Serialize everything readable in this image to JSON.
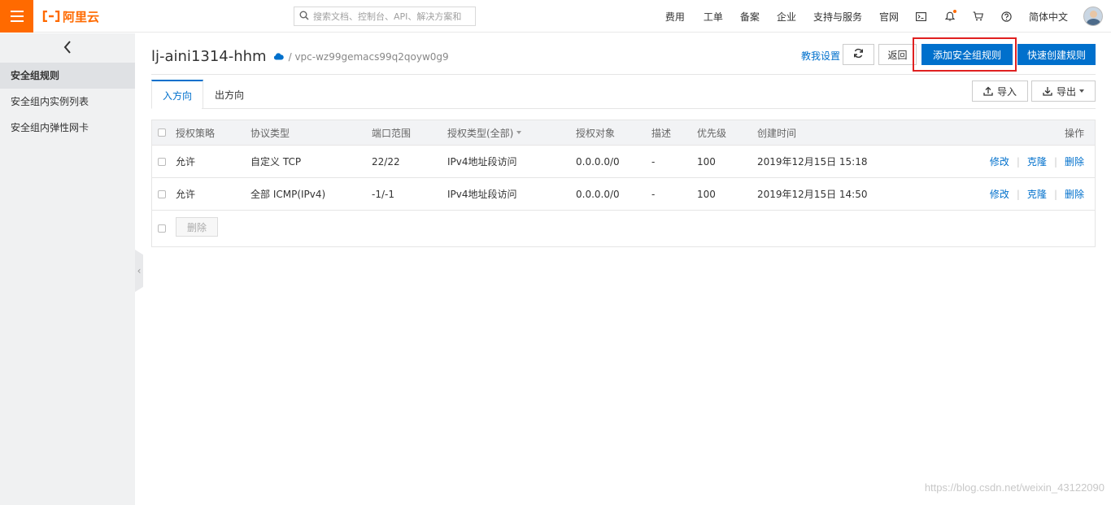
{
  "header": {
    "brand": "阿里云",
    "search_placeholder": "搜索文档、控制台、API、解决方案和",
    "nav": [
      "费用",
      "工单",
      "备案",
      "企业",
      "支持与服务",
      "官网"
    ],
    "language": "简体中文"
  },
  "sidebar": {
    "items": [
      "安全组规则",
      "安全组内实例列表",
      "安全组内弹性网卡"
    ],
    "active_index": 0
  },
  "page": {
    "title": "lj-aini1314-hhm",
    "vpc_path": "/ vpc-wz99gemacs99q2qoyw0g9",
    "teach_link": "教我设置",
    "back_label": "返回",
    "add_rule_label": "添加安全组规则",
    "quick_create_label": "快速创建规则",
    "import_label": "导入",
    "export_label": "导出"
  },
  "tabs": [
    {
      "label": "入方向",
      "active": true
    },
    {
      "label": "出方向",
      "active": false
    }
  ],
  "table": {
    "columns": [
      "授权策略",
      "协议类型",
      "端口范围",
      "授权类型(全部)",
      "授权对象",
      "描述",
      "优先级",
      "创建时间",
      "操作"
    ],
    "rows": [
      {
        "policy": "允许",
        "protocol": "自定义 TCP",
        "port": "22/22",
        "auth_type": "IPv4地址段访问",
        "target": "0.0.0.0/0",
        "desc": "-",
        "priority": "100",
        "created": "2019年12月15日 15:18"
      },
      {
        "policy": "允许",
        "protocol": "全部 ICMP(IPv4)",
        "port": "-1/-1",
        "auth_type": "IPv4地址段访问",
        "target": "0.0.0.0/0",
        "desc": "-",
        "priority": "100",
        "created": "2019年12月15日 14:50"
      }
    ],
    "row_actions": [
      "修改",
      "克隆",
      "删除"
    ],
    "bulk_delete_label": "删除"
  },
  "watermark": "https://blog.csdn.net/weixin_43122090",
  "colors": {
    "brand_orange": "#ff6a00",
    "primary_blue": "#0070cc",
    "highlight_red": "#e02020"
  }
}
